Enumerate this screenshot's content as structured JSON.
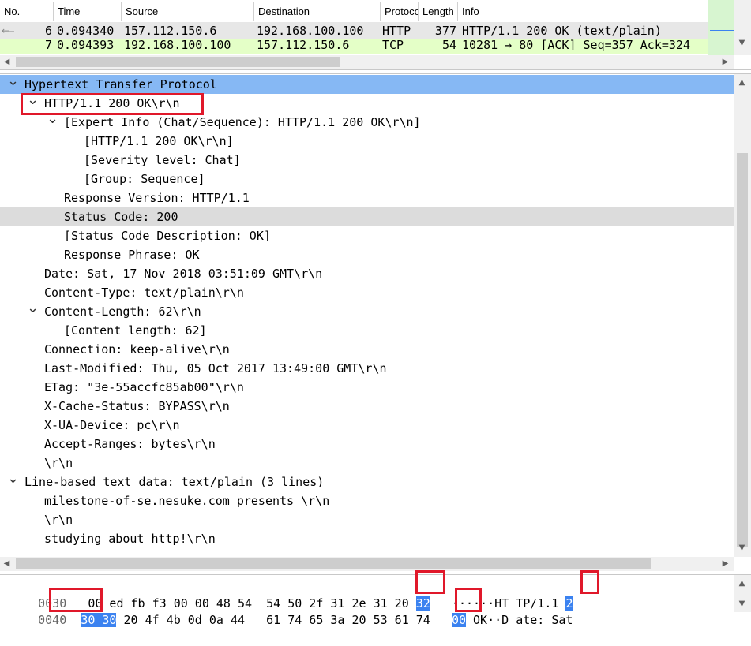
{
  "packet_list": {
    "columns": [
      "No.",
      "Time",
      "Source",
      "Destination",
      "Protocol",
      "Length",
      "Info"
    ],
    "rows": [
      {
        "no": "6",
        "time": "0.094340",
        "source": "157.112.150.6",
        "destination": "192.168.100.100",
        "protocol": "HTTP",
        "length": "377",
        "info": "HTTP/1.1 200 OK  (text/plain)",
        "bg": "#e4ffc7"
      },
      {
        "no": "7",
        "time": "0.094393",
        "source": "192.168.100.100",
        "destination": "157.112.150.6",
        "protocol": "TCP",
        "length": "54",
        "info": "10281 → 80 [ACK] Seq=357 Ack=324",
        "bg": "#e4ffc7"
      }
    ],
    "selected_row_bg": "#e7e7e7"
  },
  "details": {
    "rows": [
      {
        "text": "Hypertext Transfer Protocol",
        "toggle": "v"
      },
      {
        "text": "HTTP/1.1 200 OK\\r\\n",
        "toggle": "v"
      },
      {
        "text": "[Expert Info (Chat/Sequence): HTTP/1.1 200 OK\\r\\n]",
        "toggle": "v"
      },
      {
        "text": "[HTTP/1.1 200 OK\\r\\n]",
        "toggle": ""
      },
      {
        "text": "[Severity level: Chat]",
        "toggle": ""
      },
      {
        "text": "[Group: Sequence]",
        "toggle": ""
      },
      {
        "text": "Response Version: HTTP/1.1",
        "toggle": ""
      },
      {
        "text": "Status Code: 200",
        "toggle": ""
      },
      {
        "text": "[Status Code Description: OK]",
        "toggle": ""
      },
      {
        "text": "Response Phrase: OK",
        "toggle": ""
      },
      {
        "text": "Date: Sat, 17 Nov 2018 03:51:09 GMT\\r\\n",
        "toggle": ""
      },
      {
        "text": "Content-Type: text/plain\\r\\n",
        "toggle": ""
      },
      {
        "text": "Content-Length: 62\\r\\n",
        "toggle": "v"
      },
      {
        "text": "[Content length: 62]",
        "toggle": ""
      },
      {
        "text": "Connection: keep-alive\\r\\n",
        "toggle": ""
      },
      {
        "text": "Last-Modified: Thu, 05 Oct 2017 13:49:00 GMT\\r\\n",
        "toggle": ""
      },
      {
        "text": "ETag: \"3e-55accfc85ab00\"\\r\\n",
        "toggle": ""
      },
      {
        "text": "X-Cache-Status: BYPASS\\r\\n",
        "toggle": ""
      },
      {
        "text": "X-UA-Device: pc\\r\\n",
        "toggle": ""
      },
      {
        "text": "Accept-Ranges: bytes\\r\\n",
        "toggle": ""
      },
      {
        "text": "\\r\\n",
        "toggle": ""
      },
      {
        "text": "Line-based text data: text/plain (3 lines)",
        "toggle": "v"
      },
      {
        "text": "milestone-of-se.nesuke.com presents \\r\\n",
        "toggle": ""
      },
      {
        "text": "\\r\\n",
        "toggle": ""
      },
      {
        "text": "studying about http!\\r\\n",
        "toggle": ""
      }
    ],
    "selected_bg": "#86b8f4",
    "hover_bg": "#dcdcdc"
  },
  "hex": {
    "rows": [
      {
        "offset": "0030",
        "bytes_a": "00 ed fb f3 00 00 48 54",
        "bytes_b": "54 50 2f 31 2e 31 20",
        "bytes_b_hl": "32",
        "ascii_pre": "······HT TP/1.1 ",
        "ascii_hl": "2",
        "ascii_post": ""
      },
      {
        "offset": "0040",
        "bytes_a_hl": "30 30",
        "bytes_a": " 20 4f 4b 0d 0a 44",
        "bytes_b": "61 74 65 3a 20 53 61 74",
        "ascii_hl": "00",
        "ascii_post": " OK··D ate: Sat"
      }
    ]
  },
  "colors": {
    "highlight_red": "#e0182a",
    "hex_highlight": "#3b82f0"
  }
}
